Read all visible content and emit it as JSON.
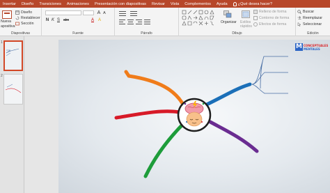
{
  "tabs": [
    "Insertar",
    "Diseño",
    "Transiciones",
    "Animaciones",
    "Presentación con diapositivas",
    "Revisar",
    "Vista",
    "Complementos",
    "Ayuda"
  ],
  "tell_me": "¿Qué desea hacer?",
  "ribbon": {
    "slides": {
      "new_slide": "Nueva",
      "new_slide_2": "apositiva",
      "layout": "Diseño",
      "reset": "Restablecer",
      "section": "Sección",
      "label": "Diapositivas"
    },
    "font": {
      "bold": "N",
      "italic": "K",
      "underline": "S",
      "strike": "abc",
      "label": "Fuente"
    },
    "paragraph": {
      "label": "Párrafo"
    },
    "drawing": {
      "arrange": "Organizar",
      "quick_styles": "Estilos",
      "quick_styles_2": "rápidos",
      "fill": "Relleno de forma",
      "outline": "Contorno de forma",
      "effects": "Efectos de forma",
      "label": "Dibujo"
    },
    "editing": {
      "find": "Buscar",
      "replace": "Reemplazar",
      "select": "Seleccionar",
      "label": "Edición"
    }
  },
  "slide_numbers": [
    "1",
    "2"
  ],
  "logo": {
    "letter": "M",
    "line1": "CONCEPTUALES",
    "line2": "MENTALES"
  },
  "colors": {
    "tab_bar": "#b7472a",
    "branch_orange": "#f07c1a",
    "branch_red": "#d71a28",
    "branch_green": "#1d9c3a",
    "branch_blue": "#1b6fb8",
    "branch_purple": "#6a2c91",
    "lines_blue": "#4a6fa5"
  }
}
